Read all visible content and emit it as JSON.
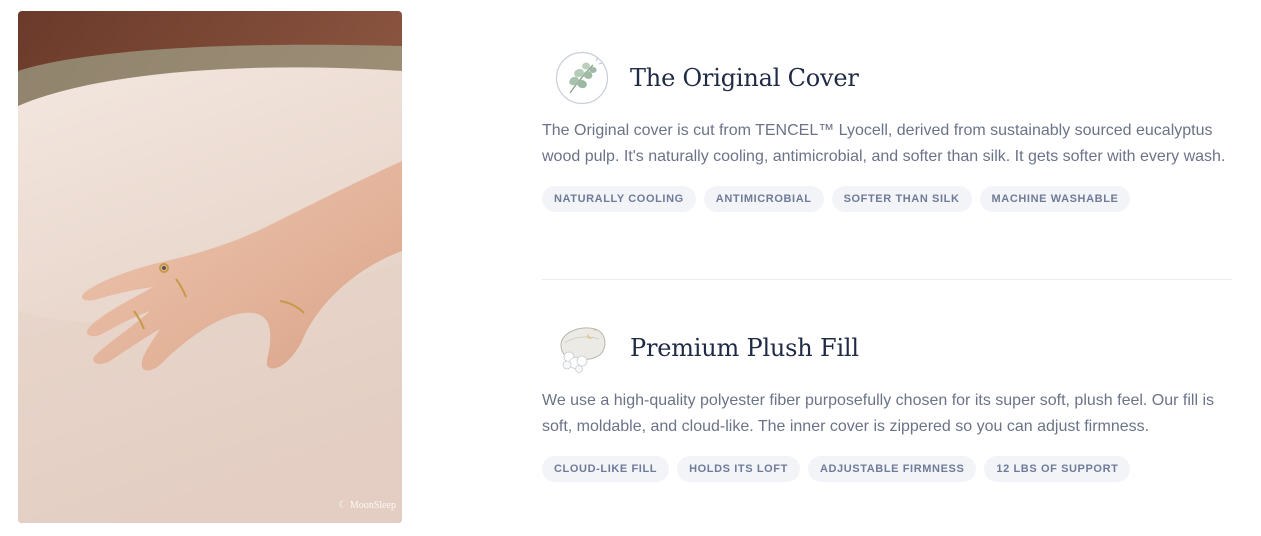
{
  "photo": {
    "alt": "Hand resting on a plush pillow",
    "watermark": "☾ MoonSleep"
  },
  "features": [
    {
      "icon": "eucalyptus-icon",
      "title": "The Original Cover",
      "body": "The Original cover is cut from TENCEL™ Lyocell, derived from sustainably sourced eucalyptus wood pulp. It's naturally cooling, antimicrobial, and softer than silk. It gets softer with every wash.",
      "tags": [
        "Naturally Cooling",
        "Antimicrobial",
        "Softer Than Silk",
        "Machine Washable"
      ]
    },
    {
      "icon": "pillow-fill-icon",
      "title": "Premium Plush Fill",
      "body": "We use a high-quality polyester fiber purposefully chosen for its super soft, plush feel. Our fill is soft, moldable, and cloud-like. The inner cover is zippered so you can adjust firmness.",
      "tags": [
        "Cloud-Like Fill",
        "Holds Its Loft",
        "Adjustable Firmness",
        "12 LBS of Support"
      ]
    }
  ]
}
